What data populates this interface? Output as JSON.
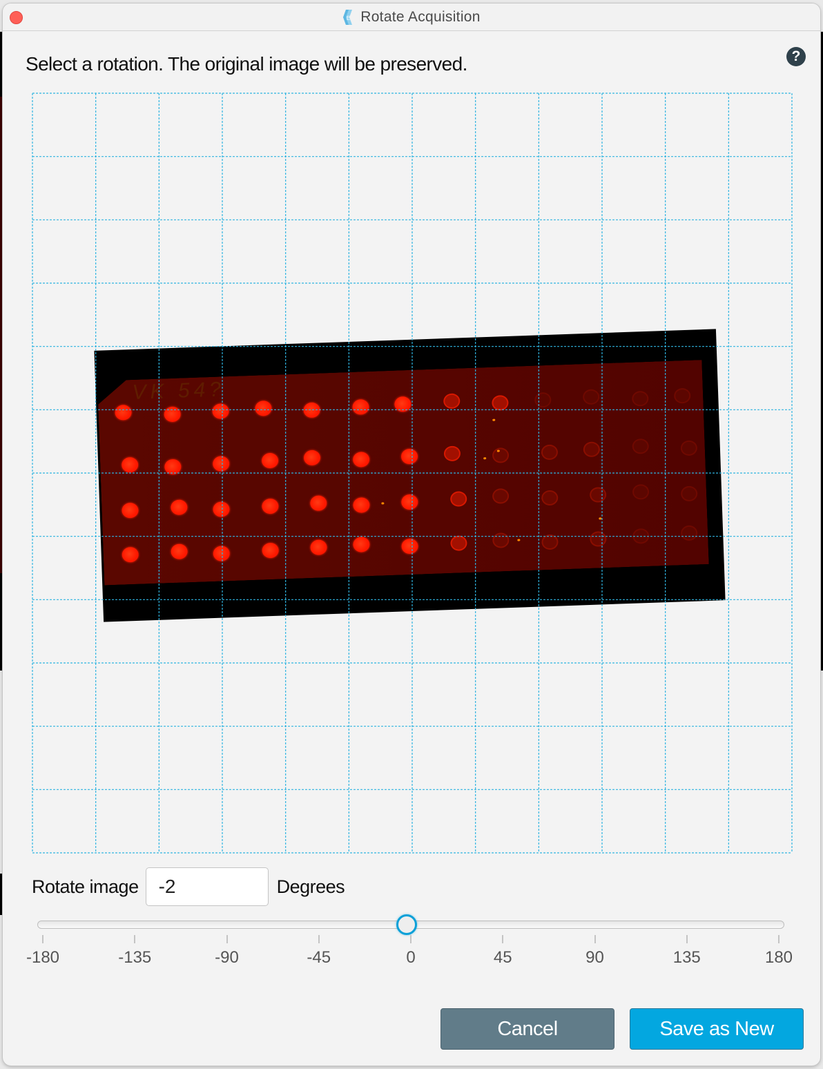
{
  "window": {
    "title": "Rotate Acquisition",
    "app_icon": "app-logo-icon",
    "close_icon": "close-icon"
  },
  "instruction": "Select a rotation. The original image will be preserved.",
  "help": {
    "icon": "help-icon",
    "glyph": "?"
  },
  "preview": {
    "grid_color": "#2fb4e0",
    "grid_divisions": 12,
    "rotation_deg": -2,
    "slide_writing": "VK 54?",
    "spot_rows": [
      [
        "strong",
        "strong",
        "strong",
        "strong",
        "strong",
        "strong",
        "strong",
        "medium",
        "medium",
        "trace",
        "trace",
        "trace",
        "trace"
      ],
      [
        "strong",
        "strong",
        "strong",
        "strong",
        "strong",
        "strong",
        "strong",
        "medium",
        "faint",
        "faint",
        "faint",
        "trace",
        "trace"
      ],
      [
        "strong",
        "strong",
        "strong",
        "strong",
        "strong",
        "strong",
        "strong",
        "medium",
        "faint",
        "faint",
        "faint",
        "trace",
        "trace"
      ],
      [
        "strong",
        "strong",
        "strong",
        "strong",
        "strong",
        "strong",
        "strong",
        "medium",
        "faint",
        "faint",
        "faint",
        "trace",
        "trace"
      ]
    ]
  },
  "rotate": {
    "label": "Rotate image",
    "value": "-2",
    "unit": "Degrees"
  },
  "slider": {
    "min": -180,
    "max": 180,
    "value": -2,
    "ticks": [
      "-180",
      "-135",
      "-90",
      "-45",
      "0",
      "45",
      "90",
      "135",
      "180"
    ],
    "accent": "#0aa0d8"
  },
  "buttons": {
    "cancel": "Cancel",
    "save": "Save as New"
  },
  "colors": {
    "cancel_bg": "#617c89",
    "save_bg": "#03a7e0",
    "close": "#fe5f57"
  }
}
